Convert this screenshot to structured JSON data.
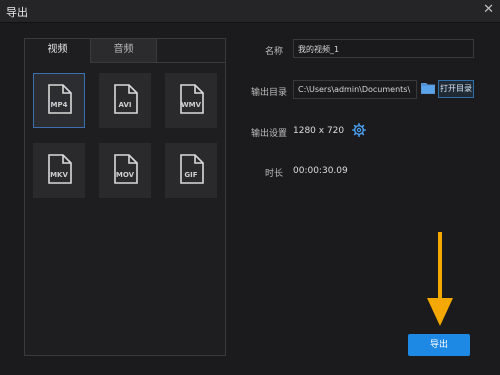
{
  "window": {
    "title": "导出",
    "close_glyph": "✕"
  },
  "tabs": [
    {
      "label": "视频"
    },
    {
      "label": "音频"
    }
  ],
  "formats": [
    {
      "label": "MP4",
      "selected": true
    },
    {
      "label": "AVI"
    },
    {
      "label": "WMV"
    },
    {
      "label": "MKV"
    },
    {
      "label": "MOV"
    },
    {
      "label": "GIF"
    }
  ],
  "form": {
    "name_label": "名称",
    "name_value": "我的视频_1",
    "dir_label": "输出目录",
    "dir_value": "C:\\Users\\admin\\Documents\\",
    "open_dir_label": "打开目录",
    "settings_label": "输出设置",
    "settings_value": "1280 x 720",
    "duration_label": "时长",
    "duration_value": "00:00:30.09"
  },
  "export_label": "导出",
  "colors": {
    "accent": "#1e88e5",
    "arrow": "#f5a800",
    "selected_border": "#3b6fb0"
  }
}
